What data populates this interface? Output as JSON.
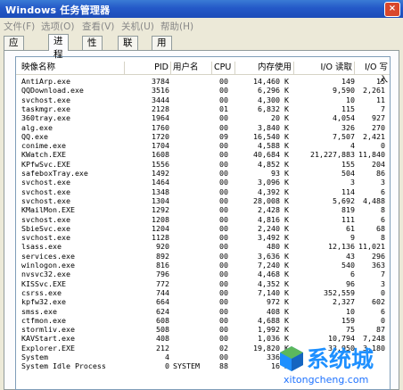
{
  "window": {
    "title": "Windows 任务管理器",
    "close_label": "×"
  },
  "menu": [
    "文件(F)",
    "选项(O)",
    "查看(V)",
    "关机(U)",
    "帮助(H)"
  ],
  "tabs": [
    "应用程序",
    "进程",
    "性能",
    "联网",
    "用户"
  ],
  "active_tab": 1,
  "columns": [
    "映像名称",
    "PID",
    "用户名",
    "CPU",
    "内存使用",
    "I/O 读取",
    "I/O 写入"
  ],
  "processes": [
    {
      "name": "AntiArp.exe",
      "pid": "3784",
      "user": "",
      "cpu": "00",
      "mem": "14,460 K",
      "io_read": "149",
      "io_write": "15"
    },
    {
      "name": "QQDownload.exe",
      "pid": "3516",
      "user": "",
      "cpu": "00",
      "mem": "6,296 K",
      "io_read": "9,590",
      "io_write": "2,261"
    },
    {
      "name": "svchost.exe",
      "pid": "3444",
      "user": "",
      "cpu": "00",
      "mem": "4,300 K",
      "io_read": "10",
      "io_write": "11"
    },
    {
      "name": "taskmgr.exe",
      "pid": "2128",
      "user": "",
      "cpu": "01",
      "mem": "6,832 K",
      "io_read": "115",
      "io_write": "7"
    },
    {
      "name": "360tray.exe",
      "pid": "1964",
      "user": "",
      "cpu": "00",
      "mem": "20 K",
      "io_read": "4,054",
      "io_write": "927"
    },
    {
      "name": "alg.exe",
      "pid": "1760",
      "user": "",
      "cpu": "00",
      "mem": "3,840 K",
      "io_read": "326",
      "io_write": "270"
    },
    {
      "name": "QQ.exe",
      "pid": "1720",
      "user": "",
      "cpu": "09",
      "mem": "16,540 K",
      "io_read": "7,507",
      "io_write": "2,421"
    },
    {
      "name": "conime.exe",
      "pid": "1704",
      "user": "",
      "cpu": "00",
      "mem": "4,588 K",
      "io_read": "4",
      "io_write": "0"
    },
    {
      "name": "KWatch.EXE",
      "pid": "1608",
      "user": "",
      "cpu": "00",
      "mem": "40,684 K",
      "io_read": "21,227,883",
      "io_write": "11,840"
    },
    {
      "name": "KPfwSvc.EXE",
      "pid": "1556",
      "user": "",
      "cpu": "00",
      "mem": "4,852 K",
      "io_read": "155",
      "io_write": "204"
    },
    {
      "name": "safeboxTray.exe",
      "pid": "1492",
      "user": "",
      "cpu": "00",
      "mem": "93 K",
      "io_read": "504",
      "io_write": "86"
    },
    {
      "name": "svchost.exe",
      "pid": "1464",
      "user": "",
      "cpu": "00",
      "mem": "3,096 K",
      "io_read": "3",
      "io_write": "3"
    },
    {
      "name": "svchost.exe",
      "pid": "1348",
      "user": "",
      "cpu": "00",
      "mem": "4,392 K",
      "io_read": "114",
      "io_write": "6"
    },
    {
      "name": "svchost.exe",
      "pid": "1304",
      "user": "",
      "cpu": "00",
      "mem": "28,008 K",
      "io_read": "5,692",
      "io_write": "4,488"
    },
    {
      "name": "KMailMon.EXE",
      "pid": "1292",
      "user": "",
      "cpu": "00",
      "mem": "2,428 K",
      "io_read": "819",
      "io_write": "8"
    },
    {
      "name": "svchost.exe",
      "pid": "1208",
      "user": "",
      "cpu": "00",
      "mem": "4,816 K",
      "io_read": "111",
      "io_write": "6"
    },
    {
      "name": "SbieSvc.exe",
      "pid": "1204",
      "user": "",
      "cpu": "00",
      "mem": "2,240 K",
      "io_read": "61",
      "io_write": "68"
    },
    {
      "name": "svchost.exe",
      "pid": "1128",
      "user": "",
      "cpu": "00",
      "mem": "3,492 K",
      "io_read": "9",
      "io_write": "8"
    },
    {
      "name": "lsass.exe",
      "pid": "920",
      "user": "",
      "cpu": "00",
      "mem": "480 K",
      "io_read": "12,136",
      "io_write": "11,021"
    },
    {
      "name": "services.exe",
      "pid": "892",
      "user": "",
      "cpu": "00",
      "mem": "3,636 K",
      "io_read": "43",
      "io_write": "296"
    },
    {
      "name": "winlogon.exe",
      "pid": "816",
      "user": "",
      "cpu": "00",
      "mem": "7,240 K",
      "io_read": "540",
      "io_write": "363"
    },
    {
      "name": "nvsvc32.exe",
      "pid": "796",
      "user": "",
      "cpu": "00",
      "mem": "4,468 K",
      "io_read": "6",
      "io_write": "7"
    },
    {
      "name": "KISSvc.EXE",
      "pid": "772",
      "user": "",
      "cpu": "00",
      "mem": "4,352 K",
      "io_read": "96",
      "io_write": "3"
    },
    {
      "name": "csrss.exe",
      "pid": "744",
      "user": "",
      "cpu": "00",
      "mem": "7,140 K",
      "io_read": "352,559",
      "io_write": "0"
    },
    {
      "name": "kpfw32.exe",
      "pid": "664",
      "user": "",
      "cpu": "00",
      "mem": "972 K",
      "io_read": "2,327",
      "io_write": "602"
    },
    {
      "name": "smss.exe",
      "pid": "624",
      "user": "",
      "cpu": "00",
      "mem": "408 K",
      "io_read": "10",
      "io_write": "6"
    },
    {
      "name": "ctfmon.exe",
      "pid": "608",
      "user": "",
      "cpu": "00",
      "mem": "4,688 K",
      "io_read": "159",
      "io_write": "0"
    },
    {
      "name": "stormliv.exe",
      "pid": "508",
      "user": "",
      "cpu": "00",
      "mem": "1,992 K",
      "io_read": "75",
      "io_write": "87"
    },
    {
      "name": "KAVStart.exe",
      "pid": "408",
      "user": "",
      "cpu": "00",
      "mem": "1,036 K",
      "io_read": "10,794",
      "io_write": "7,248"
    },
    {
      "name": "Explorer.EXE",
      "pid": "212",
      "user": "",
      "cpu": "02",
      "mem": "19,820 K",
      "io_read": "33,950",
      "io_write": "3,180"
    },
    {
      "name": "System",
      "pid": "4",
      "user": "",
      "cpu": "00",
      "mem": "336 K",
      "io_read": "",
      "io_write": ""
    },
    {
      "name": "System Idle Process",
      "pid": "0",
      "user": "SYSTEM",
      "cpu": "88",
      "mem": "16 K",
      "io_read": "",
      "io_write": ""
    }
  ],
  "watermark": {
    "text": "系统城",
    "url": "xitongcheng.com"
  },
  "colors": {
    "titlebar": "#2459c8",
    "watermark": "#1e90ff",
    "logo_green": "#5cb85c",
    "logo_blue": "#1e90ff"
  }
}
